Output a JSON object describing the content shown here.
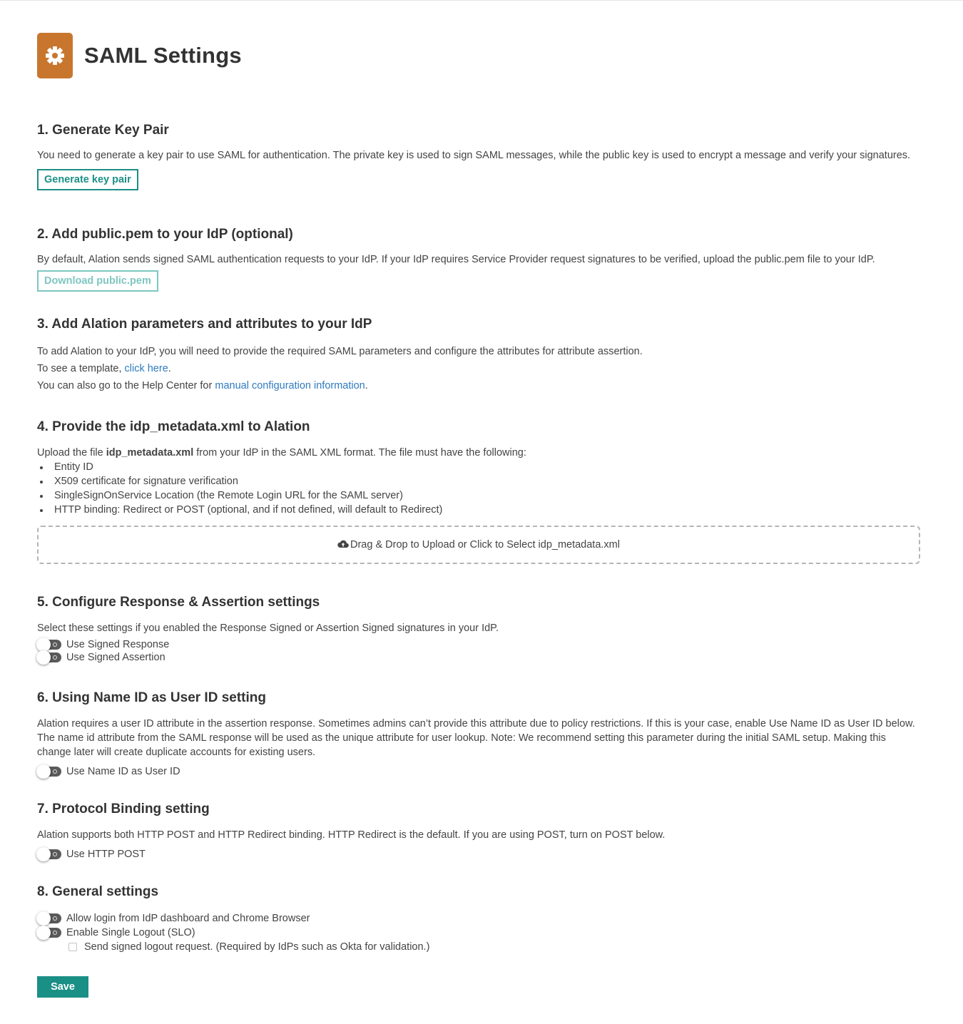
{
  "header": {
    "title": "SAML Settings",
    "icon": "gear-icon",
    "icon_color": "#c8762e"
  },
  "accent_color": "#1a8f86",
  "s1": {
    "title": "1. Generate Key Pair",
    "desc": "You need to generate a key pair to use SAML for authentication. The private key is used to sign SAML messages, while the public key is used to encrypt a message and verify your signatures.",
    "button": "Generate key pair"
  },
  "s2": {
    "title": "2. Add public.pem to your IdP (optional)",
    "desc": "By default, Alation sends signed SAML authentication requests to your IdP. If your IdP requires Service Provider request signatures to be verified, upload the public.pem file to your IdP.",
    "button": "Download public.pem"
  },
  "s3": {
    "title": "3. Add Alation parameters and attributes to your IdP",
    "line1": "To add Alation to your IdP, you will need to provide the required SAML parameters and configure the attributes for attribute assertion.",
    "line2_prefix": "To see a template, ",
    "line2_link": "click here",
    "line2_suffix": ".",
    "line3_prefix": "You can also go to the Help Center for ",
    "line3_link": "manual configuration information",
    "line3_suffix": "."
  },
  "s4": {
    "title": "4. Provide the idp_metadata.xml to Alation",
    "desc_prefix": "Upload the file ",
    "desc_bold": "idp_metadata.xml",
    "desc_suffix": " from your IdP in the SAML XML format. The file must have the following:",
    "bullets": [
      "Entity ID",
      "X509 certificate for signature verification",
      "SingleSignOnService Location (the Remote Login URL for the SAML server)",
      "HTTP binding: Redirect or POST (optional, and if not defined, will default to Redirect)"
    ],
    "dropzone": "Drag & Drop to Upload or Click to Select idp_metadata.xml",
    "dropzone_icon": "cloud-upload-icon"
  },
  "s5": {
    "title": "5. Configure Response & Assertion settings",
    "desc": "Select these settings if you enabled the Response Signed or Assertion Signed signatures in your IdP.",
    "toggles": [
      "Use Signed Response",
      "Use Signed Assertion"
    ]
  },
  "s6": {
    "title": "6. Using Name ID as User ID setting",
    "desc": "Alation requires a user ID attribute in the assertion response. Sometimes admins can’t provide this attribute due to policy restrictions. If this is your case, enable Use Name ID as User ID below. The name id attribute from the SAML response will be used as the unique attribute for user lookup. Note: We recommend setting this parameter during the initial SAML setup. Making this change later will create duplicate accounts for existing users.",
    "toggle": "Use Name ID as User ID"
  },
  "s7": {
    "title": "7. Protocol Binding setting",
    "desc": "Alation supports both HTTP POST and HTTP Redirect binding. HTTP Redirect is the default. If you are using POST, turn on POST below.",
    "toggle": "Use HTTP POST"
  },
  "s8": {
    "title": "8. General settings",
    "toggles": [
      "Allow login from IdP dashboard and Chrome Browser",
      "Enable Single Logout (SLO)"
    ],
    "checkbox": "Send signed logout request. (Required by IdPs such as Okta for validation.)"
  },
  "save_label": "Save"
}
